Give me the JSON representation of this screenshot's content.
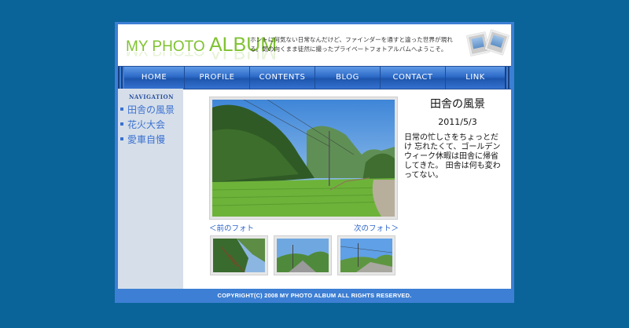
{
  "header": {
    "logo_small": "MY PHOTO ",
    "logo_big": "ALBUM",
    "tagline": "ホントに何気ない日常なんだけど、ファインダーを通すと違った世界が現れる。気の向くまま徒然に撮ったプライベートフォトアルバムへようこそ。",
    "icon": "photo-stack-icon"
  },
  "nav": {
    "items": [
      "HOME",
      "PROFILE",
      "CONTENTS",
      "BLOG",
      "CONTACT",
      "LINK"
    ]
  },
  "sidebar": {
    "heading": "NAVIGATION",
    "links": [
      "田舎の風景",
      "花火大会",
      "愛車自慢"
    ]
  },
  "gallery": {
    "prev_label": "＜前のフォト",
    "next_label": "次のフォト＞",
    "title": "田舎の風景",
    "date": "2011/5/3",
    "description": "日常の忙しさをちょっとだけ 忘れたくて、ゴールデンウィーク休暇は田舎に帰省してきた。 田舎は何も変わってない。"
  },
  "footer": {
    "copyright": "COPYRIGHT(C) 2008 MY PHOTO ALBUM ALL RIGHTS RESERVED."
  },
  "colors": {
    "page_bg": "#0a6499",
    "frame_blue": "#3d7fd4",
    "logo_green": "#7fc230",
    "link_blue": "#3b70d1",
    "sidebar_bg": "#d6dfe9"
  }
}
